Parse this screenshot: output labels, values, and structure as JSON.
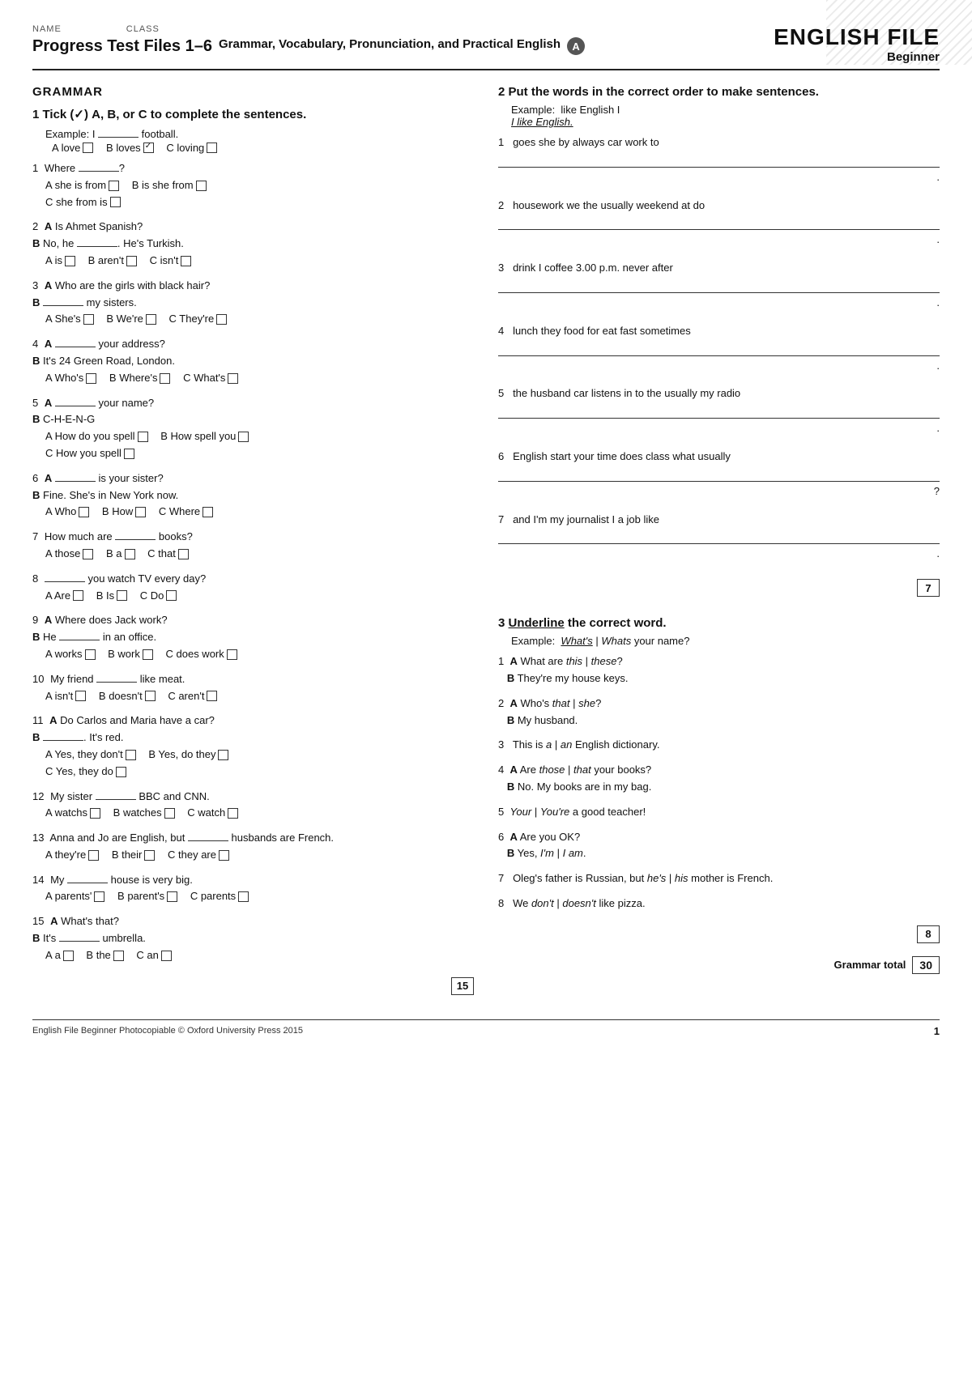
{
  "header": {
    "name_label": "NAME",
    "class_label": "CLASS",
    "test_title": "Progress Test  Files 1–6",
    "test_subtitle": "Grammar, Vocabulary, Pronunciation, and Practical English",
    "badge": "A",
    "logo": "ENGLISH FILE",
    "level": "Beginner"
  },
  "grammar": {
    "section_title": "GRAMMAR",
    "q1": {
      "num": "1",
      "intro": "Tick (✓) A, B, or C to complete the sentences.",
      "example_label": "Example:",
      "example_text": "I _______ football.",
      "example_options": [
        {
          "label": "A",
          "text": "love",
          "checked": false
        },
        {
          "label": "B",
          "text": "loves",
          "checked": true
        },
        {
          "label": "C",
          "text": "loving",
          "checked": false
        }
      ],
      "questions": [
        {
          "num": "1",
          "bold_part": "",
          "text": "Where _______?",
          "options_line1": [
            {
              "label": "A",
              "text": "she is from"
            },
            {
              "label": "B",
              "text": "is she from"
            }
          ],
          "options_line2": [
            {
              "label": "C",
              "text": "she from is"
            }
          ]
        },
        {
          "num": "2",
          "bold_label": "A",
          "bold_text": " Is Ahmet Spanish?",
          "bold_b": "B",
          "b_text": " No, he _______. He's Turkish.",
          "options_line1": [
            {
              "label": "A",
              "text": "is"
            },
            {
              "label": "B",
              "text": "aren't"
            },
            {
              "label": "C",
              "text": "isn't"
            }
          ]
        },
        {
          "num": "3",
          "bold_label": "A",
          "bold_text": " Who are the girls with black hair?",
          "bold_b": "B",
          "b_text": " _______ my sisters.",
          "options_line1": [
            {
              "label": "A",
              "text": "She's"
            },
            {
              "label": "B",
              "text": "We're"
            },
            {
              "label": "C",
              "text": "They're"
            }
          ]
        },
        {
          "num": "4",
          "bold_label": "A",
          "bold_text": " _______ your address?",
          "bold_b": "B",
          "b_text": " It's 24 Green Road, London.",
          "options_line1": [
            {
              "label": "A",
              "text": "Who's"
            },
            {
              "label": "B",
              "text": "Where's"
            },
            {
              "label": "C",
              "text": "What's"
            }
          ]
        },
        {
          "num": "5",
          "bold_label": "A",
          "bold_text": " _______ your name?",
          "bold_b": "B",
          "b_text": " C-H-E-N-G",
          "options_line1": [
            {
              "label": "A",
              "text": "How do you spell"
            },
            {
              "label": "B",
              "text": "How spell you"
            }
          ],
          "options_line2": [
            {
              "label": "C",
              "text": "How you spell"
            }
          ]
        },
        {
          "num": "6",
          "bold_label": "A",
          "bold_text": " _______ is your sister?",
          "bold_b": "B",
          "b_text": " Fine. She's in New York now.",
          "options_line1": [
            {
              "label": "A",
              "text": "Who"
            },
            {
              "label": "B",
              "text": "How"
            },
            {
              "label": "C",
              "text": "Where"
            }
          ]
        },
        {
          "num": "7",
          "text": "How much are _______ books?",
          "options_line1": [
            {
              "label": "A",
              "text": "those"
            },
            {
              "label": "B",
              "text": "a"
            },
            {
              "label": "C",
              "text": "that"
            }
          ]
        },
        {
          "num": "8",
          "text": "_______ you watch TV every day?",
          "options_line1": [
            {
              "label": "A",
              "text": "Are"
            },
            {
              "label": "B",
              "text": "Is"
            },
            {
              "label": "C",
              "text": "Do"
            }
          ]
        },
        {
          "num": "9",
          "bold_label": "A",
          "bold_text": " Where does Jack work?",
          "bold_b": "B",
          "b_text": " He _______ in an office.",
          "options_line1": [
            {
              "label": "A",
              "text": "works"
            },
            {
              "label": "B",
              "text": "work"
            },
            {
              "label": "C",
              "text": "does work"
            }
          ]
        },
        {
          "num": "10",
          "text": "My friend _______ like meat.",
          "options_line1": [
            {
              "label": "A",
              "text": "isn't"
            },
            {
              "label": "B",
              "text": "doesn't"
            },
            {
              "label": "C",
              "text": "aren't"
            }
          ]
        },
        {
          "num": "11",
          "bold_label": "A",
          "bold_text": " Do Carlos and Maria have a car?",
          "bold_b": "B",
          "b_text": " _______. It's red.",
          "options_line1": [
            {
              "label": "A",
              "text": "Yes, they don't"
            },
            {
              "label": "B",
              "text": "Yes, do they"
            }
          ],
          "options_line2": [
            {
              "label": "C",
              "text": "Yes, they do"
            }
          ]
        },
        {
          "num": "12",
          "text": "My sister _______ BBC and CNN.",
          "options_line1": [
            {
              "label": "A",
              "text": "watchs"
            },
            {
              "label": "B",
              "text": "watches"
            },
            {
              "label": "C",
              "text": "watch"
            }
          ]
        },
        {
          "num": "13",
          "text": "Anna and Jo are English, but _______ husbands are French.",
          "options_line1": [
            {
              "label": "A",
              "text": "they're"
            },
            {
              "label": "B",
              "text": "their"
            },
            {
              "label": "C",
              "text": "they are"
            }
          ]
        },
        {
          "num": "14",
          "text": "My _______ house is very big.",
          "options_line1": [
            {
              "label": "A",
              "text": "parents'"
            },
            {
              "label": "B",
              "text": "parent's"
            },
            {
              "label": "C",
              "text": "parents"
            }
          ]
        },
        {
          "num": "15",
          "bold_label": "A",
          "bold_text": " What's that?",
          "bold_b": "B",
          "b_text": " It's _______ umbrella.",
          "options_line1": [
            {
              "label": "A",
              "text": "a"
            },
            {
              "label": "B",
              "text": "the"
            },
            {
              "label": "C",
              "text": "an"
            }
          ]
        }
      ],
      "score": "15"
    },
    "q2": {
      "num": "2",
      "intro": "Put the words in the correct order to make sentences.",
      "example_label": "Example:",
      "example_prompt": "like English I",
      "example_answer": "I like English.",
      "questions": [
        {
          "num": "1",
          "text": "goes she by always car work to"
        },
        {
          "num": "2",
          "text": "housework we the usually weekend at do"
        },
        {
          "num": "3",
          "text": "drink I coffee 3.00 p.m. never after"
        },
        {
          "num": "4",
          "text": "lunch they food for eat fast sometimes"
        },
        {
          "num": "5",
          "text": "the husband car listens in to the usually my radio"
        },
        {
          "num": "6",
          "text": "English start your time does class what usually",
          "end_mark": "?"
        },
        {
          "num": "7",
          "text": "and I'm my journalist I a job like"
        }
      ],
      "score": "7"
    },
    "q3": {
      "num": "3",
      "intro_underline": "Underline",
      "intro_rest": " the correct word.",
      "example_label": "Example:",
      "example_text": "What's | Whats your name?",
      "example_underlined": "What's",
      "questions": [
        {
          "num": "1",
          "bold_a": "A",
          "a_text": " What are ",
          "option1": "this",
          "sep": " | ",
          "option2": "these",
          "a_end": "?",
          "bold_b": "B",
          "b_text": " They're my house keys."
        },
        {
          "num": "2",
          "bold_a": "A",
          "a_text": " Who's ",
          "option1": "that",
          "sep": " | ",
          "option2": "she",
          "a_end": "?",
          "bold_b": "B",
          "b_text": " My husband."
        },
        {
          "num": "3",
          "text": "This is ",
          "option1": "a",
          "sep": " | ",
          "option2": "an",
          "rest": " English dictionary."
        },
        {
          "num": "4",
          "bold_a": "A",
          "a_text": " Are ",
          "option1": "those",
          "sep": " | ",
          "option2": "that",
          "a_end": " your books?",
          "bold_b": "B",
          "b_text": " No. My books are in my bag."
        },
        {
          "num": "5",
          "option1": "Your",
          "sep": " | ",
          "option2": "You're",
          "rest": " a good teacher!"
        },
        {
          "num": "6",
          "bold_a": "A",
          "a_text": " Are you OK?",
          "bold_b": "B",
          "b_text": " Yes, ",
          "option1": "I'm",
          "sep": " | ",
          "option2": "I am",
          "b_end": "."
        },
        {
          "num": "7",
          "text": "Oleg's father is Russian, but ",
          "option1": "he's",
          "sep": " | ",
          "option2": "his",
          "rest": " mother is French."
        },
        {
          "num": "8",
          "text": "We ",
          "option1": "don't",
          "sep": " | ",
          "option2": "doesn't",
          "rest": " like pizza."
        }
      ],
      "score": "8"
    },
    "grammar_total_label": "Grammar total",
    "grammar_total_score": "30"
  },
  "footer": {
    "copyright": "English File Beginner Photocopiable © Oxford University Press 2015",
    "page_num": "1"
  }
}
